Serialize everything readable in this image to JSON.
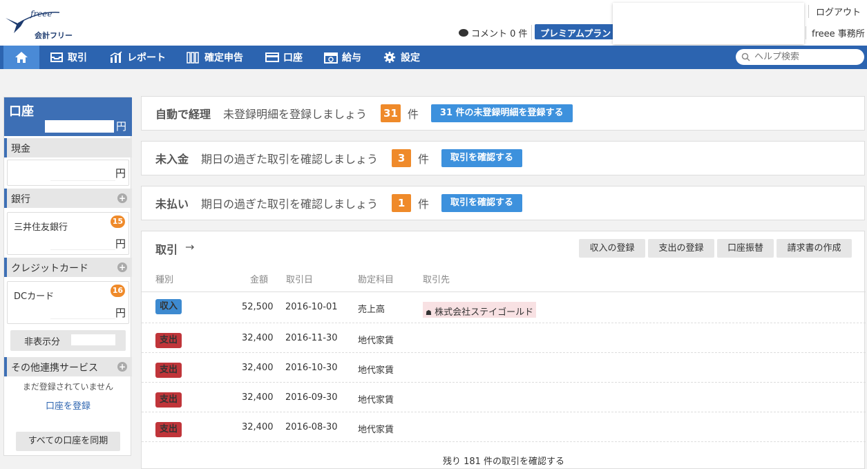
{
  "header": {
    "logo_text": "会計フリー",
    "comment": "コメント 0 件",
    "premium": "プレミアムプラン",
    "logout": "ログアウト",
    "office": "freee 事務所"
  },
  "nav": {
    "items": [
      "取引",
      "レポート",
      "確定申告",
      "口座",
      "給与",
      "設定"
    ],
    "help_placeholder": "ヘルプ検索"
  },
  "sidebar": {
    "title": "口座",
    "yen": "円",
    "cash_label": "現金",
    "bank_label": "銀行",
    "bank_name": "三井住友銀行",
    "bank_badge": "15",
    "credit_label": "クレジットカード",
    "card_name": "DCカード",
    "card_badge": "16",
    "hidden_label": "非表示分",
    "other_label": "その他連携サービス",
    "other_note": "まだ登録されていません",
    "register_link": "口座を登録",
    "sync_all": "すべての口座を同期"
  },
  "alerts": [
    {
      "label": "自動で経理",
      "msg": "未登録明細を登録しましょう",
      "count": "31",
      "unit": "件",
      "button": "31 件の未登録明細を登録する"
    },
    {
      "label": "未入金",
      "msg": "期日の過ぎた取引を確認しましょう",
      "count": "3",
      "unit": "件",
      "button": "取引を確認する"
    },
    {
      "label": "未払い",
      "msg": "期日の過ぎた取引を確認しましょう",
      "count": "1",
      "unit": "件",
      "button": "取引を確認する"
    }
  ],
  "transactions": {
    "title": "取引",
    "buttons": [
      "収入の登録",
      "支出の登録",
      "口座振替",
      "請求書の作成"
    ],
    "headers": [
      "種別",
      "金額",
      "取引日",
      "勘定科目",
      "取引先"
    ],
    "rows": [
      {
        "type": "収入",
        "kind": "in",
        "amount": "52,500",
        "date": "2016-10-01",
        "account": "売上高",
        "partner": "株式会社ステイゴールド"
      },
      {
        "type": "支出",
        "kind": "out",
        "amount": "32,400",
        "date": "2016-11-30",
        "account": "地代家賃",
        "partner": ""
      },
      {
        "type": "支出",
        "kind": "out",
        "amount": "32,400",
        "date": "2016-10-30",
        "account": "地代家賃",
        "partner": ""
      },
      {
        "type": "支出",
        "kind": "out",
        "amount": "32,400",
        "date": "2016-09-30",
        "account": "地代家賃",
        "partner": ""
      },
      {
        "type": "支出",
        "kind": "out",
        "amount": "32,400",
        "date": "2016-08-30",
        "account": "地代家賃",
        "partner": ""
      }
    ],
    "more": "残り 181 件の取引を確認する"
  }
}
